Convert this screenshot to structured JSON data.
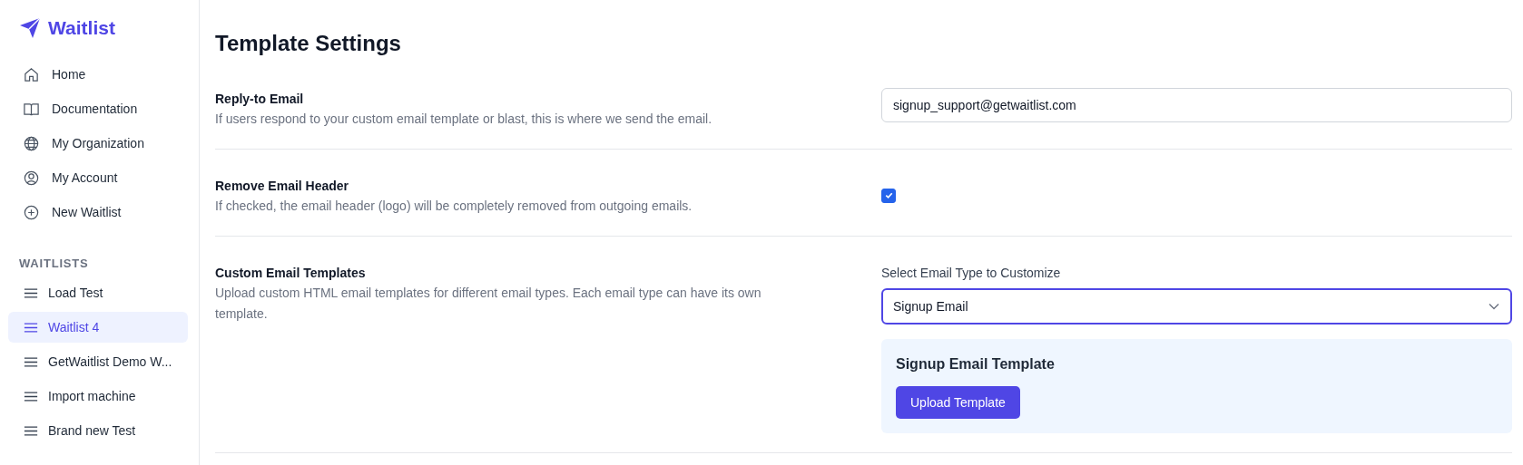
{
  "brand": {
    "name": "Waitlist"
  },
  "nav": [
    {
      "label": "Home"
    },
    {
      "label": "Documentation"
    },
    {
      "label": "My Organization"
    },
    {
      "label": "My Account"
    },
    {
      "label": "New Waitlist"
    }
  ],
  "waitlists": {
    "heading": "WAITLISTS",
    "items": [
      {
        "label": "Load Test",
        "selected": false
      },
      {
        "label": "Waitlist 4",
        "selected": true
      },
      {
        "label": "GetWaitlist Demo W...",
        "selected": false
      },
      {
        "label": "Import machine",
        "selected": false
      },
      {
        "label": "Brand new Test",
        "selected": false
      }
    ]
  },
  "page": {
    "title": "Template Settings"
  },
  "sections": [
    {
      "kind": "text",
      "title": "Reply-to Email",
      "description": "If users respond to your custom email template or blast, this is where we send the email.",
      "value": "signup_support@getwaitlist.com"
    },
    {
      "kind": "checkbox",
      "title": "Remove Email Header",
      "description": "If checked, the email header (logo) will be completely removed from outgoing emails.",
      "checked": true
    },
    {
      "kind": "templates",
      "title": "Custom Email Templates",
      "description": "Upload custom HTML email templates for different email types. Each email type can have its own template.",
      "select_label": "Select Email Type to Customize",
      "select_value": "Signup Email",
      "card_title": "Signup Email Template",
      "button": "Upload Template"
    }
  ]
}
